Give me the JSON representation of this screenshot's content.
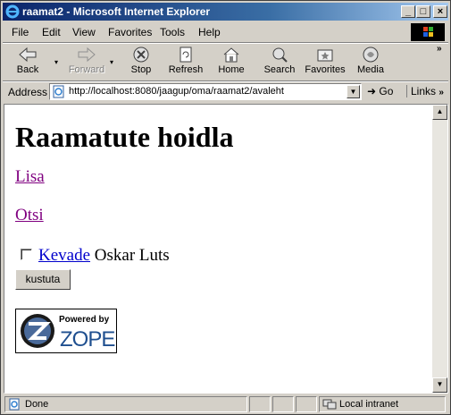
{
  "window": {
    "title": "raamat2 - Microsoft Internet Explorer"
  },
  "menu": [
    "File",
    "Edit",
    "View",
    "Favorites",
    "Tools",
    "Help"
  ],
  "toolbar": {
    "back": "Back",
    "forward": "Forward",
    "stop": "Stop",
    "refresh": "Refresh",
    "home": "Home",
    "search": "Search",
    "favorites": "Favorites",
    "media": "Media"
  },
  "address": {
    "label": "Address",
    "url": "http://localhost:8080/jaagup/oma/raamat2/avaleht",
    "go": "Go",
    "links": "Links"
  },
  "page": {
    "heading": "Raamatute hoidla",
    "links": [
      "Lisa",
      "Otsi"
    ],
    "book": {
      "title": "Kevade",
      "author": "Oskar Luts"
    },
    "delete_button": "kustuta",
    "badge": {
      "line1": "Powered by",
      "line2": "ZOPE"
    }
  },
  "status": {
    "left": "Done",
    "zone": "Local intranet"
  },
  "colors": {
    "titlebar": "#0a246a",
    "visited_link": "#800080",
    "link": "#0000cc",
    "chrome": "#d4d0c8"
  }
}
